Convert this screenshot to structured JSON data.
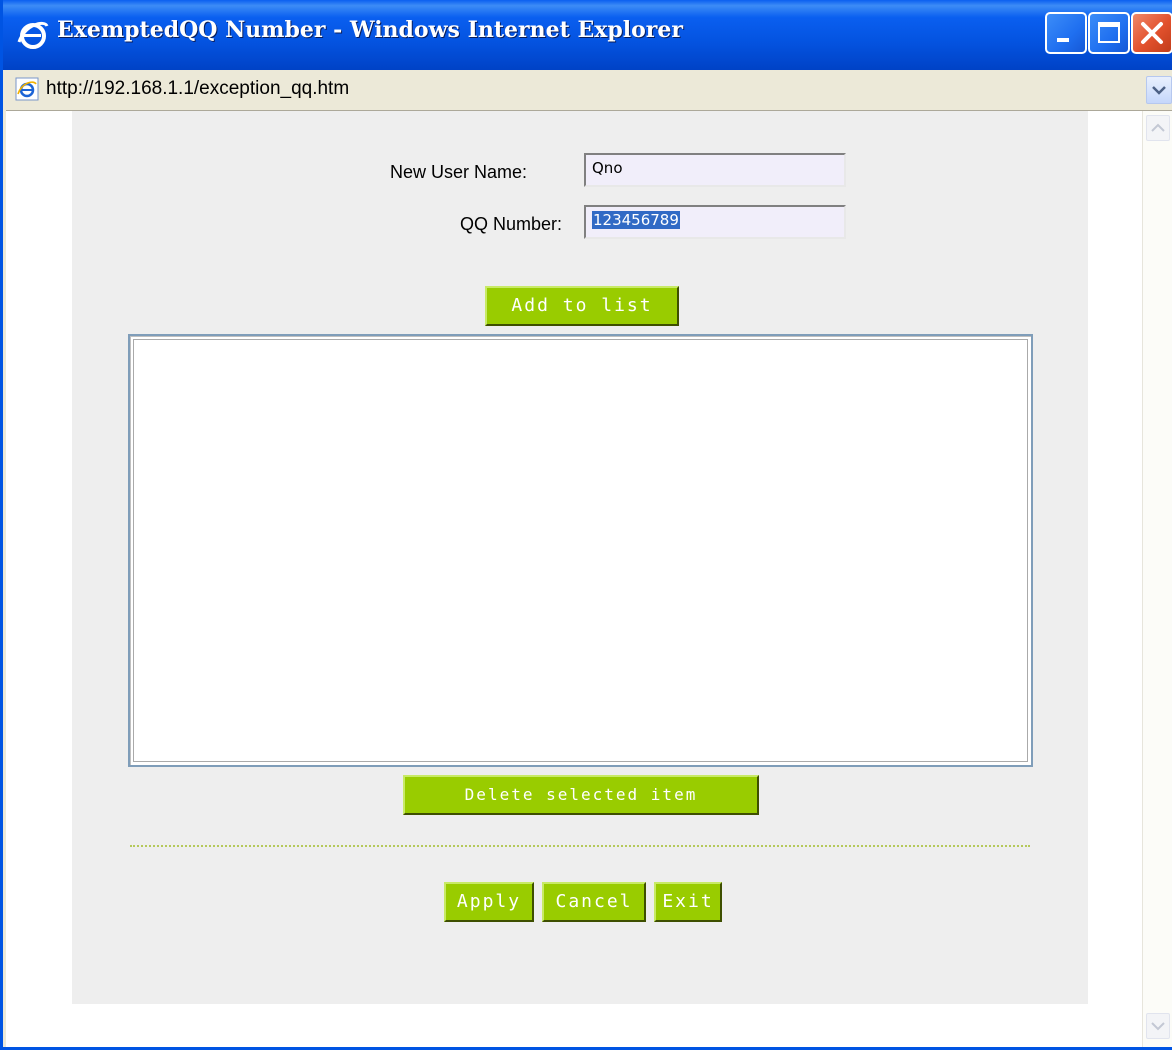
{
  "window": {
    "title": "ExemptedQQ Number - Windows Internet Explorer",
    "icon": "ie-icon"
  },
  "address": {
    "url": "http://192.168.1.1/exception_qq.htm"
  },
  "form": {
    "username_label": "New User Name:",
    "username_value": "Qno",
    "qq_label": "QQ Number:",
    "qq_value": "123456789"
  },
  "buttons": {
    "add": "Add to list",
    "delete": "Delete selected item",
    "apply": "Apply",
    "cancel": "Cancel",
    "exit": "Exit"
  },
  "list": {
    "items": []
  },
  "colors": {
    "button_green": "#99cc00",
    "panel_bg": "#eeeeee",
    "titlebar_blue": "#0a5ff0"
  }
}
